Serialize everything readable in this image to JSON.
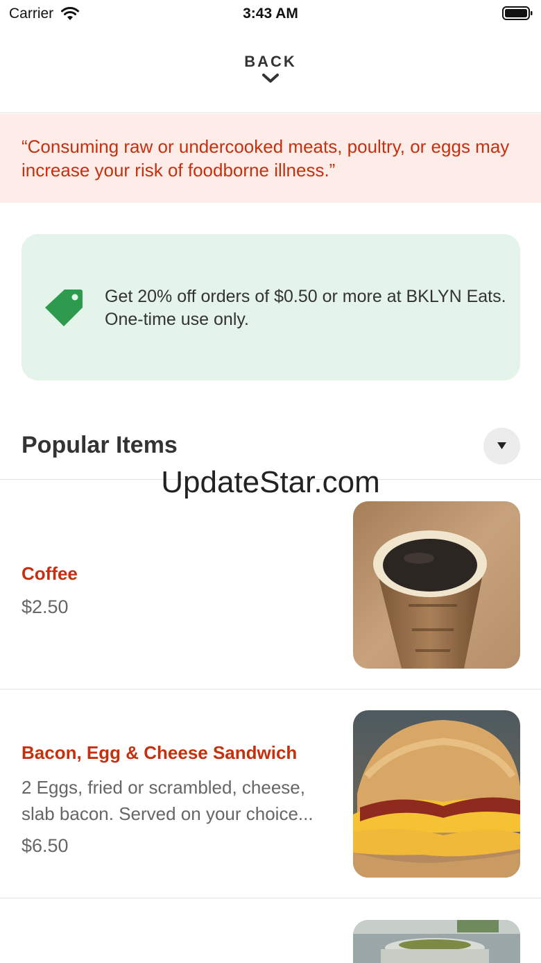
{
  "status_bar": {
    "carrier": "Carrier",
    "time": "3:43 AM"
  },
  "nav": {
    "back_label": "BACK"
  },
  "warning": {
    "text": "“Consuming raw or undercooked meats, poultry, or eggs may increase your risk of foodborne illness.”"
  },
  "promo": {
    "text": "Get 20% off orders of $0.50 or more at BKLYN Eats. One-time use only.",
    "accent_color": "#2e9a4e"
  },
  "section": {
    "title": "Popular Items"
  },
  "watermark": "UpdateStar.com",
  "items": [
    {
      "name": "Coffee",
      "description": "",
      "price": "$2.50",
      "image": "coffee-cup-photo"
    },
    {
      "name": "Bacon, Egg & Cheese Sandwich",
      "description": "2 Eggs, fried or scrambled, cheese, slab bacon. Served on your choice...",
      "price": "$6.50",
      "image": "bagel-sandwich-photo"
    },
    {
      "name": "",
      "description": "",
      "price": "",
      "image": "cup-with-lid-photo"
    }
  ],
  "colors": {
    "brand_red": "#c5300e",
    "warning_bg": "#fdece8",
    "promo_bg": "#e5f4ea"
  }
}
